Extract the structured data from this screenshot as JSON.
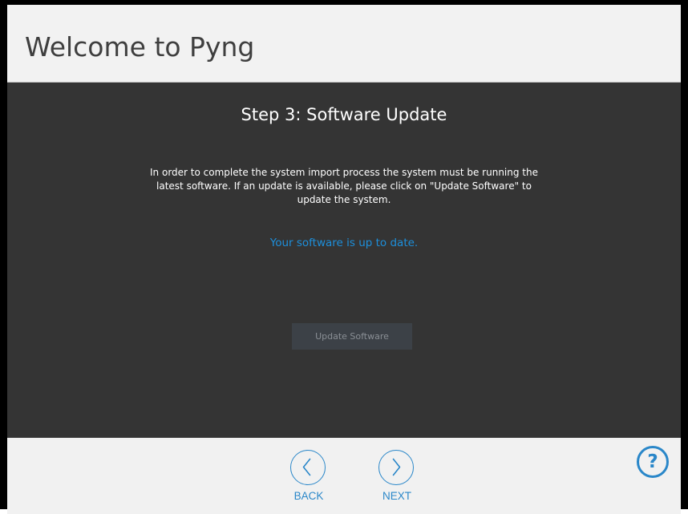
{
  "header": {
    "title": "Welcome to Pyng"
  },
  "step": {
    "title": "Step 3: Software Update",
    "description": "In order to complete the system import process the system must be running the latest software. If an update is available, please click on \"Update Software\" to update the system.",
    "status": "Your software is up to date.",
    "update_button_label": "Update Software"
  },
  "footer": {
    "back_label": "BACK",
    "next_label": "NEXT",
    "help_label": "?"
  },
  "colors": {
    "accent": "#2a87c9",
    "status": "#1d8fdb",
    "panel": "#343434",
    "header_bg": "#f2f2f2"
  },
  "icons": {
    "back": "chevron-left-icon",
    "next": "chevron-right-icon",
    "help": "question-mark-icon"
  }
}
